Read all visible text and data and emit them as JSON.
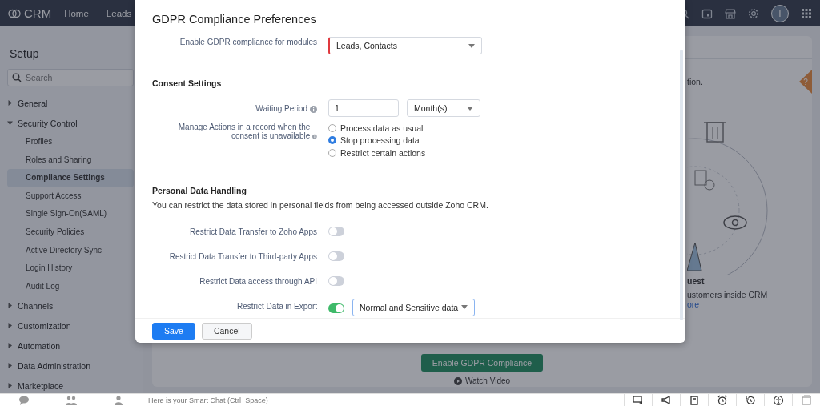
{
  "top_nav": {
    "logo": "CRM",
    "items": [
      "Home",
      "Leads"
    ],
    "avatar": "T"
  },
  "sidebar": {
    "title": "Setup",
    "search": {
      "placeholder": "Search"
    },
    "items": [
      {
        "label": "General",
        "expanded": false,
        "selected": false
      },
      {
        "label": "Security Control",
        "expanded": true,
        "selected": false,
        "children": [
          {
            "label": "Profiles",
            "selected": false
          },
          {
            "label": "Roles and Sharing",
            "selected": false
          },
          {
            "label": "Compliance Settings",
            "selected": true
          },
          {
            "label": "Support Access",
            "selected": false
          },
          {
            "label": "Single Sign-On(SAML)",
            "selected": false
          },
          {
            "label": "Security Policies",
            "selected": false
          },
          {
            "label": "Active Directory Sync",
            "selected": false
          },
          {
            "label": "Login History",
            "selected": false
          },
          {
            "label": "Audit Log",
            "selected": false
          }
        ]
      },
      {
        "label": "Channels",
        "expanded": false,
        "selected": false
      },
      {
        "label": "Customization",
        "expanded": false,
        "selected": false
      },
      {
        "label": "Automation",
        "expanded": false,
        "selected": false
      },
      {
        "label": "Data Administration",
        "expanded": false,
        "selected": false
      },
      {
        "label": "Marketplace",
        "expanded": false,
        "selected": false
      }
    ]
  },
  "background_page": {
    "intro_fragment": "tion.",
    "help_tab": "?",
    "card_title_fragment": "uest",
    "card_text_fragment": "ustomers inside CRM",
    "card_link_fragment": "ore",
    "enable_button": "Enable GDPR Compliance",
    "watch_video": "Watch Video"
  },
  "modal": {
    "title": "GDPR Compliance Preferences",
    "modules": {
      "label": "Enable GDPR compliance for modules",
      "value": "Leads, Contacts"
    },
    "consent": {
      "heading": "Consent Settings",
      "waiting_period": {
        "label": "Waiting Period",
        "value": "1",
        "unit": "Month(s)"
      },
      "actions": {
        "label": "Manage Actions in a record when the consent is unavailable",
        "options": [
          {
            "label": "Process data as usual",
            "selected": false
          },
          {
            "label": "Stop processing data",
            "selected": true
          },
          {
            "label": "Restrict certain actions",
            "selected": false
          }
        ]
      }
    },
    "personal_data": {
      "heading": "Personal Data Handling",
      "description": "You can restrict the data stored in personal fields from being accessed outside Zoho CRM.",
      "toggles": [
        {
          "label": "Restrict Data Transfer to Zoho Apps",
          "on": false
        },
        {
          "label": "Restrict Data Transfer to Third-party Apps",
          "on": false
        },
        {
          "label": "Restrict Data access through API",
          "on": false
        },
        {
          "label": "Restrict Data in Export",
          "on": true,
          "option": "Normal and Sensitive data"
        }
      ]
    },
    "buttons": [
      {
        "label": "Save",
        "kind": "primary"
      },
      {
        "label": "Cancel",
        "kind": "secondary"
      }
    ]
  },
  "smart_chat": {
    "placeholder": "Here is your Smart Chat (Ctrl+Space)"
  }
}
